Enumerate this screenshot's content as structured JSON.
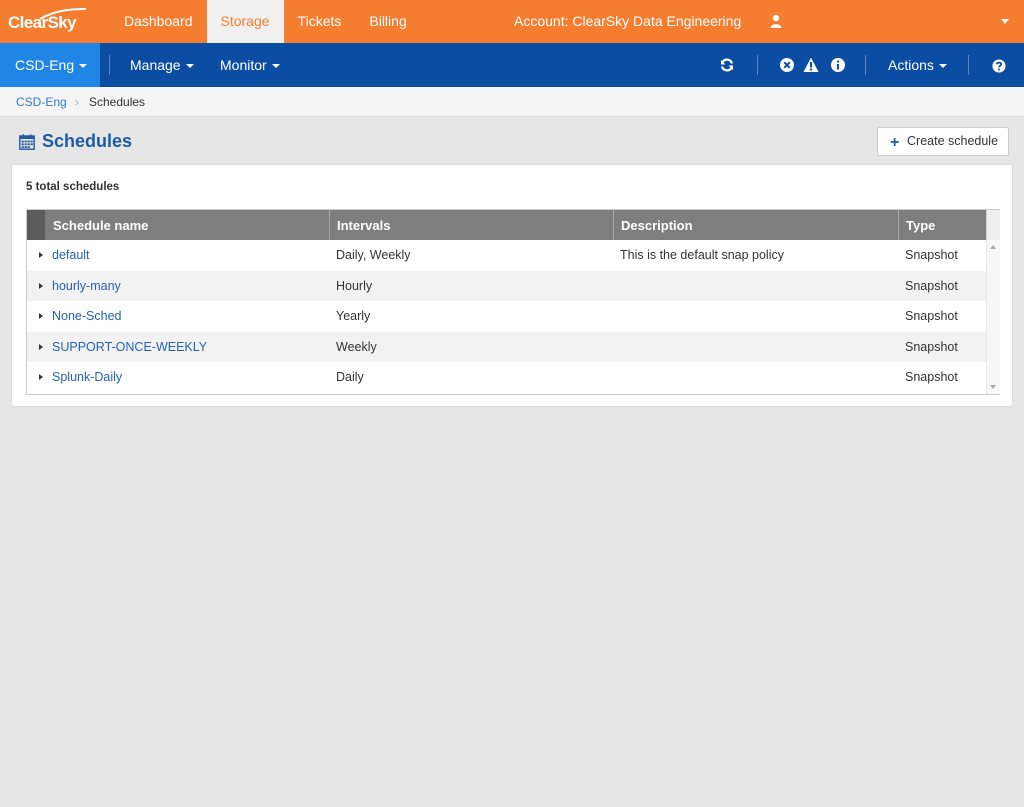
{
  "brand": {
    "logo_text": "ClearSky",
    "accent": "#f47d30",
    "nav_blue": "#0a4da3",
    "active_blue": "#1f86e6"
  },
  "top_nav": {
    "tabs": [
      {
        "label": "Dashboard",
        "active": false
      },
      {
        "label": "Storage",
        "active": true
      },
      {
        "label": "Tickets",
        "active": false
      },
      {
        "label": "Billing",
        "active": false
      }
    ],
    "account_label": "Account: ClearSky Data Engineering",
    "user_icon": "user-icon",
    "menu_icon": "caret-down-icon"
  },
  "sub_nav": {
    "context_label": "CSD-Eng",
    "manage_label": "Manage",
    "monitor_label": "Monitor",
    "actions_label": "Actions",
    "icons": [
      "refresh-icon",
      "error-icon",
      "warning-icon",
      "info-icon",
      "help-icon"
    ]
  },
  "breadcrumb": {
    "root": "CSD-Eng",
    "separator": "›",
    "current": "Schedules"
  },
  "page": {
    "title": "Schedules",
    "title_icon": "calendar-icon",
    "create_button": "Create schedule",
    "total_label": "5 total schedules"
  },
  "table": {
    "columns": [
      "Schedule name",
      "Intervals",
      "Description",
      "Type"
    ],
    "rows": [
      {
        "name": "default",
        "intervals": "Daily, Weekly",
        "description": "This is the default snap policy",
        "type": "Snapshot"
      },
      {
        "name": "hourly-many",
        "intervals": "Hourly",
        "description": "",
        "type": "Snapshot"
      },
      {
        "name": "None-Sched",
        "intervals": "Yearly",
        "description": "",
        "type": "Snapshot"
      },
      {
        "name": "SUPPORT-ONCE-WEEKLY",
        "intervals": "Weekly",
        "description": "",
        "type": "Snapshot"
      },
      {
        "name": "Splunk-Daily",
        "intervals": "Daily",
        "description": "",
        "type": "Snapshot"
      }
    ]
  }
}
